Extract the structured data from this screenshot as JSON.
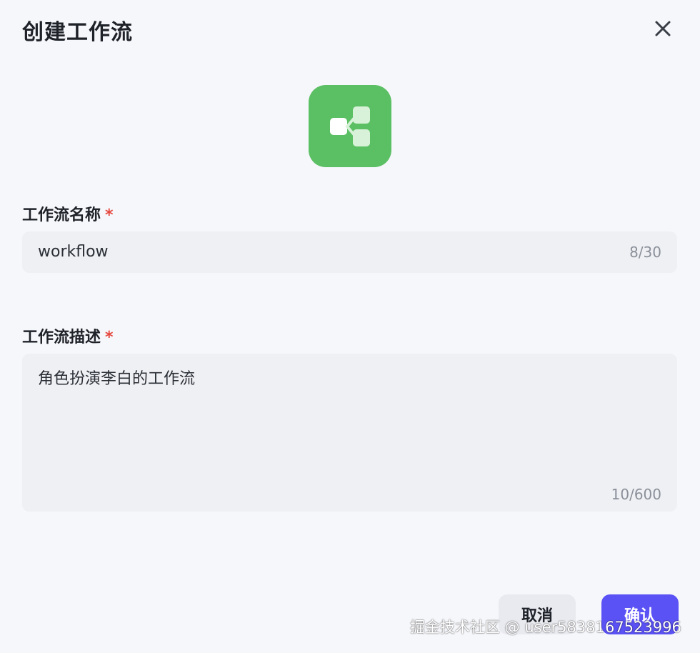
{
  "dialog": {
    "title": "创建工作流"
  },
  "colors": {
    "icon_bg": "#5bbf63",
    "primary": "#5b52f5",
    "required": "#e5483f",
    "input_bg": "#eff0f4"
  },
  "workflow_icon": "workflow-icon",
  "name_field": {
    "label": "工作流名称",
    "required_mark": "*",
    "value": "workflow",
    "counter": "8/30"
  },
  "description_field": {
    "label": "工作流描述",
    "required_mark": "*",
    "value": "角色扮演李白的工作流",
    "counter": "10/600"
  },
  "actions": {
    "cancel_label": "取消",
    "confirm_label": "确认"
  },
  "watermark": {
    "text": "掘金技术社区 @ user5838167523996"
  }
}
